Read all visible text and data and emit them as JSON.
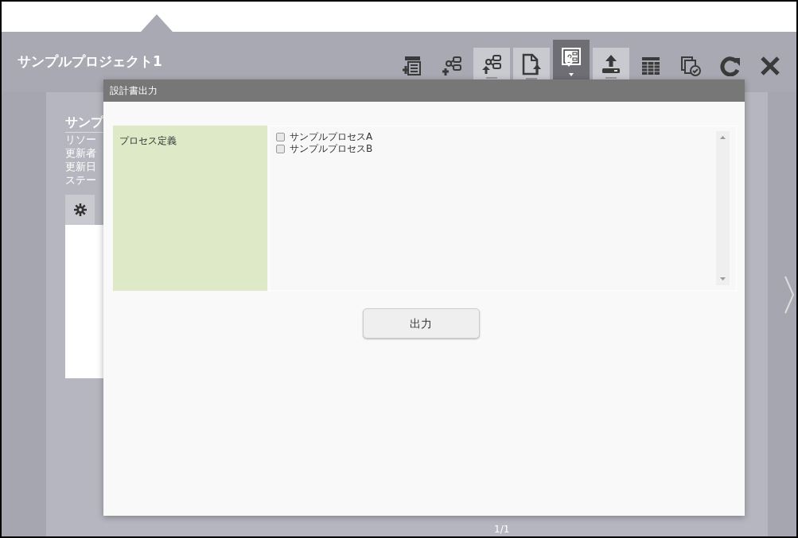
{
  "project": {
    "title": "サンプルプロジェクト1"
  },
  "toolbar": [
    {
      "kind": "table-add",
      "selected": false,
      "tabbed": false
    },
    {
      "kind": "flow-add",
      "selected": false,
      "tabbed": false
    },
    {
      "kind": "flow-up",
      "selected": false,
      "tabbed": true
    },
    {
      "kind": "doc-up",
      "selected": false,
      "tabbed": true
    },
    {
      "kind": "doc-down",
      "selected": true,
      "tabbed": true
    },
    {
      "kind": "upload",
      "selected": false,
      "tabbed": true
    },
    {
      "kind": "grid",
      "selected": false,
      "tabbed": false
    },
    {
      "kind": "check",
      "selected": false,
      "tabbed": false
    },
    {
      "kind": "refresh",
      "selected": false,
      "tabbed": false
    },
    {
      "kind": "close",
      "selected": false,
      "tabbed": false
    }
  ],
  "card": {
    "title": "サンプ",
    "lines": [
      "リソー",
      "更新者",
      "更新日",
      "ステー"
    ]
  },
  "pager": "1/1",
  "dialog": {
    "title": "設計書出力",
    "label": "プロセス定義",
    "options": [
      {
        "label": "サンプルプロセスA",
        "checked": false
      },
      {
        "label": "サンプルプロセスB",
        "checked": false
      }
    ],
    "button": "出力"
  }
}
